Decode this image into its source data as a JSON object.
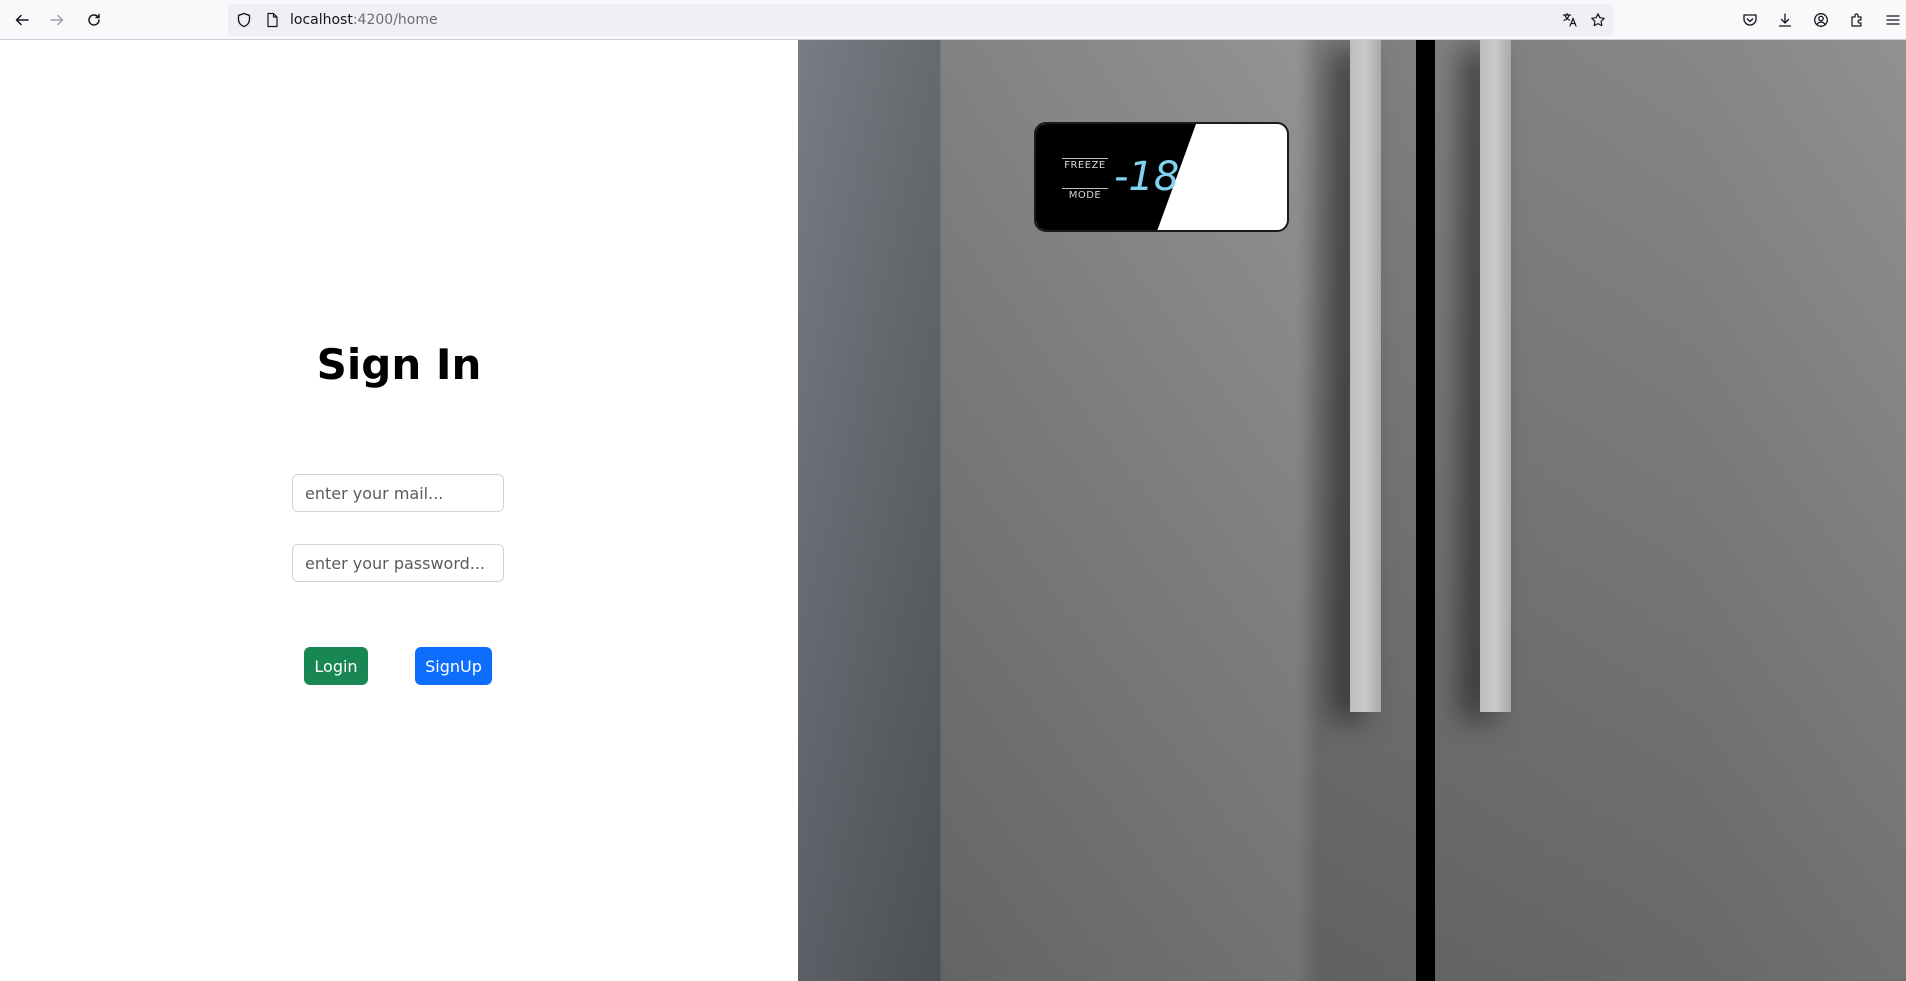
{
  "browser": {
    "url_host": "localhost",
    "url_path": ":4200/home"
  },
  "signin": {
    "title": "Sign In",
    "email_placeholder": "enter your mail...",
    "password_placeholder": "enter your password...",
    "login_label": "Login",
    "signup_label": "SignUp"
  },
  "fridge": {
    "label_top": "FREEZE",
    "label_bottom": "MODE",
    "temperature": "-18"
  },
  "colors": {
    "login_button": "#198754",
    "signup_button": "#0d6efd",
    "display_digits": "#7fd3f0"
  }
}
